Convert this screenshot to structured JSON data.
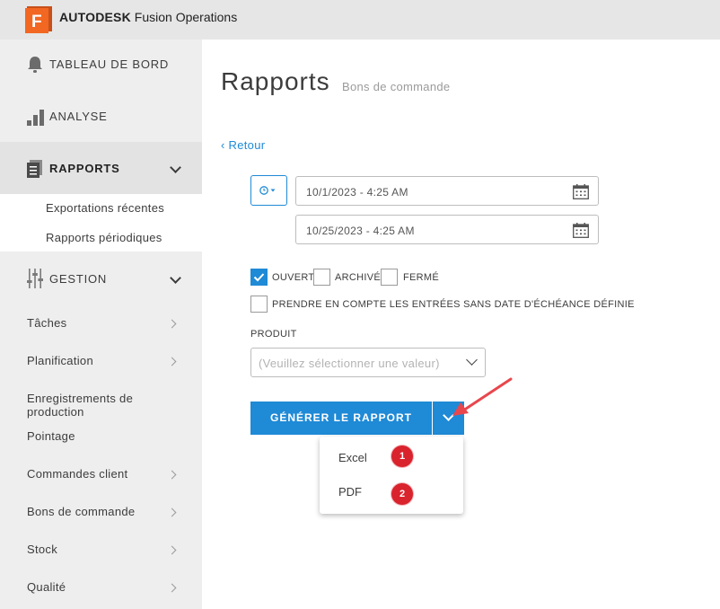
{
  "app": {
    "brand_bold": "AUTODESK",
    "brand_rest": "Fusion Operations",
    "logo_letter": "F",
    "logo_color": "#f26722"
  },
  "sidebar": {
    "top_items": [
      {
        "label": "TABLEAU DE BORD",
        "icon": "bell-icon"
      },
      {
        "label": "ANALYSE",
        "icon": "bar-chart-icon"
      },
      {
        "label": "RAPPORTS",
        "icon": "reports-icon",
        "active": true
      },
      {
        "label": "GESTION",
        "icon": "sliders-icon"
      }
    ],
    "rapports_sub": [
      "Exportations récentes",
      "Rapports périodiques"
    ],
    "gestion_items": [
      {
        "label": "Tâches"
      },
      {
        "label": "Planification"
      },
      {
        "label": "Enregistrements de production"
      },
      {
        "label": "Pointage"
      },
      {
        "label": "Commandes client"
      },
      {
        "label": "Bons de commande"
      },
      {
        "label": "Stock"
      },
      {
        "label": "Qualité"
      }
    ]
  },
  "main": {
    "title": "Rapports",
    "subtitle": "Bons de commande",
    "back": "‹ Retour",
    "date_from": "10/1/2023 - 4:25 AM",
    "date_to": "10/25/2023 - 4:25 AM",
    "checkboxes": [
      {
        "label": "OUVERT",
        "checked": true
      },
      {
        "label": "ARCHIVÉ",
        "checked": false
      },
      {
        "label": "FERMÉ",
        "checked": false
      }
    ],
    "include_no_due_date": {
      "label": "PRENDRE EN COMPTE LES ENTRÉES SANS DATE D'ÉCHÉANCE DÉFINIE",
      "checked": false
    },
    "produit_label": "PRODUIT",
    "produit_placeholder": "(Veuillez sélectionner une valeur)",
    "generate_label": "GÉNÉRER LE RAPPORT",
    "export_menu": [
      {
        "label": "Excel",
        "badge": "1"
      },
      {
        "label": "PDF",
        "badge": "2"
      }
    ]
  },
  "colors": {
    "accent": "#1f8ad6",
    "badge": "#d9232d",
    "annotation_arrow": "#e8474d"
  }
}
